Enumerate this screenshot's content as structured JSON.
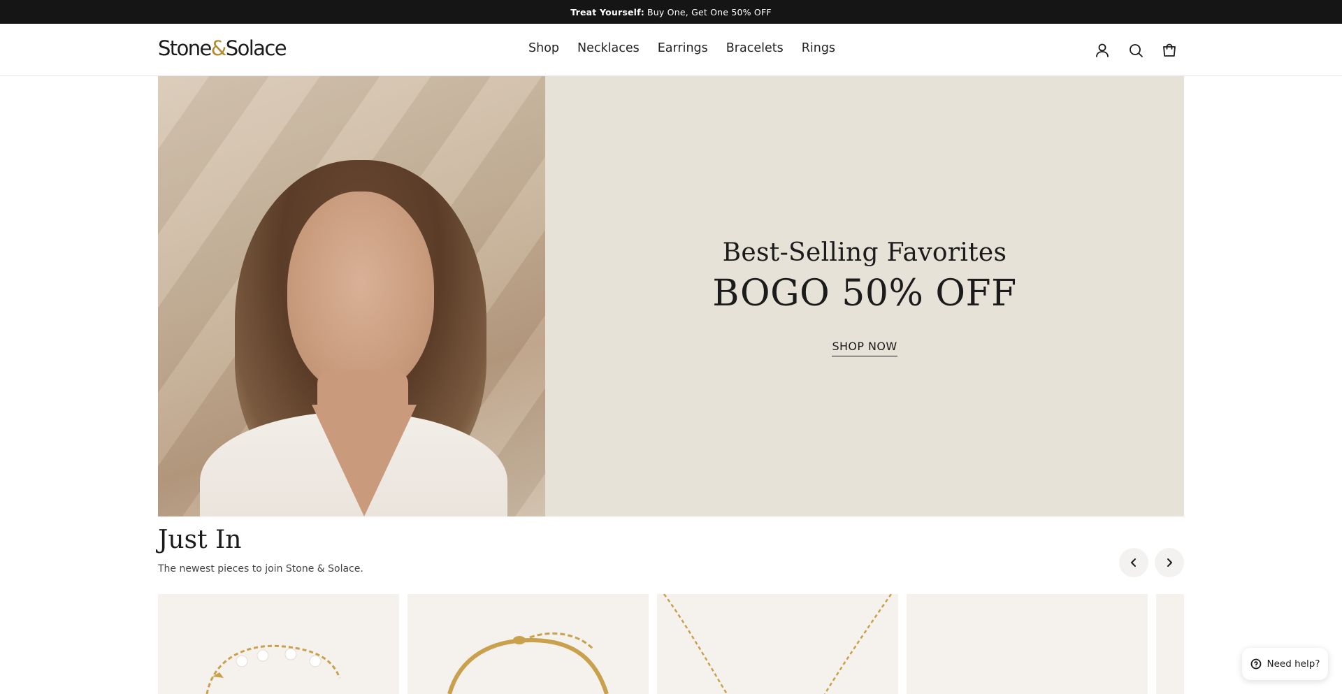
{
  "announcement": {
    "bold": "Treat Yourself:",
    "text": "Buy One, Get One 50% OFF"
  },
  "brand": {
    "logo_left": "Stone",
    "logo_amp": "&",
    "logo_right": "Solace",
    "accent_color": "#b58a2c"
  },
  "nav": {
    "items": [
      "Shop",
      "Necklaces",
      "Earrings",
      "Bracelets",
      "Rings"
    ]
  },
  "header_icons": [
    "account-icon",
    "search-icon",
    "cart-icon"
  ],
  "hero": {
    "subtitle": "Best-Selling Favorites",
    "title": "BOGO 50% OFF",
    "cta": "SHOP NOW",
    "image_alt": "model-photo",
    "panel_color": "#e7e2d7"
  },
  "just_in": {
    "title": "Just In",
    "subtitle": "The newest pieces to join Stone & Solace.",
    "prev_icon": "chevron-left-icon",
    "next_icon": "chevron-right-icon"
  },
  "products": [
    {
      "image": "pearl-chain-bracelet"
    },
    {
      "image": "gold-snake-chain-bracelet"
    },
    {
      "image": "gold-chain-necklace"
    },
    {
      "image": "product-image"
    },
    {
      "image": "product-image"
    }
  ],
  "help_button": {
    "label": "Need help?",
    "icon": "help-circle-icon"
  }
}
